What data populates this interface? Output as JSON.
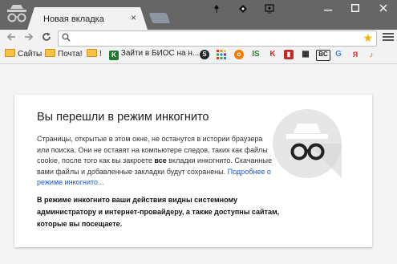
{
  "tab": {
    "title": "Новая вкладка",
    "close": "×"
  },
  "omnibox": {
    "value": "",
    "placeholder": ""
  },
  "bookmarks": {
    "folders": [
      {
        "label": "Сайты"
      },
      {
        "label": "Почта!"
      },
      {
        "label": "!"
      }
    ],
    "site_link": "Зайти в БИОС на н..."
  },
  "page": {
    "title": "Вы перешли в режим инкогнито",
    "desc_part1": "Страницы, открытые в этом окне, не останутся в истории браузера или поиска. Они не оставят на компьютере следов, таких как файлы cookie, после того как вы закроете ",
    "desc_bold": "все",
    "desc_part2": " вкладки инкогнито. Скачанные вами файлы и добавленные закладки будут сохранены. ",
    "desc_link": "Подробнее о режиме инкогнито...",
    "warning": "В режиме инкогнито ваши действия видны системному администратору и интернет-провайдеру, а также доступны сайтам, которые вы посещаете."
  },
  "colors": {
    "titlebar": "#666666",
    "link": "#1a55c9",
    "close_hover": "#d9534f"
  }
}
